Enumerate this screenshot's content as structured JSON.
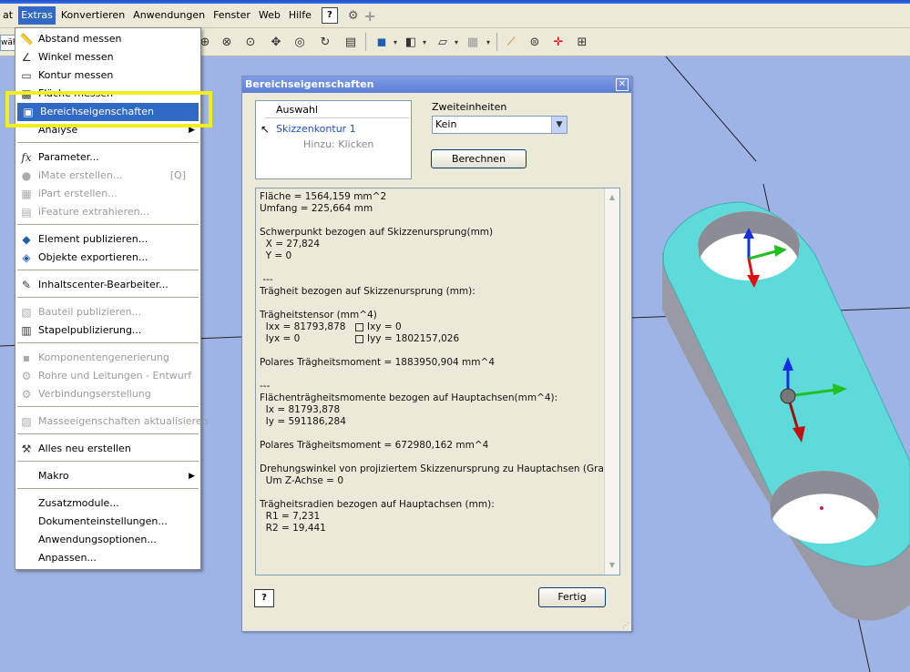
{
  "menubar": {
    "items": [
      "at",
      "Extras",
      "Konvertieren",
      "Anwendungen",
      "Fenster",
      "Web",
      "Hilfe"
    ],
    "combo_text": "wäh"
  },
  "menu": {
    "items": [
      {
        "label": "Abstand messen",
        "icon": "ruler-icon",
        "enabled": true
      },
      {
        "label": "Winkel messen",
        "icon": "angle-icon",
        "enabled": true
      },
      {
        "label": "Kontur messen",
        "icon": "loop-icon",
        "enabled": true
      },
      {
        "label": "Fläche messen",
        "icon": "area-icon",
        "enabled": true
      },
      {
        "label": "Bereichseigenschaften",
        "icon": "region-properties-icon",
        "enabled": true,
        "selected": true
      },
      {
        "label": "Analyse",
        "icon": "",
        "enabled": true,
        "submenu": true
      },
      {
        "label": "Parameter...",
        "icon": "fx-icon",
        "enabled": true
      },
      {
        "label": "iMate erstellen...",
        "icon": "imate-icon",
        "enabled": false,
        "shortcut": "[Q]"
      },
      {
        "label": "iPart erstellen...",
        "icon": "ipart-icon",
        "enabled": false
      },
      {
        "label": "iFeature extrahieren...",
        "icon": "ifeature-icon",
        "enabled": false
      },
      {
        "label": "Element publizieren...",
        "icon": "publish-icon",
        "enabled": true
      },
      {
        "label": "Objekte exportieren...",
        "icon": "export-icon",
        "enabled": true
      },
      {
        "label": "Inhaltscenter-Bearbeiter...",
        "icon": "content-center-icon",
        "enabled": true
      },
      {
        "label": "Bauteil publizieren...",
        "icon": "part-publish-icon",
        "enabled": false
      },
      {
        "label": "Stapelpublizierung...",
        "icon": "batch-publish-icon",
        "enabled": true
      },
      {
        "label": "Komponentengenerierung",
        "icon": "component-icon",
        "enabled": false
      },
      {
        "label": "Rohre und Leitungen - Entwurf",
        "icon": "pipes-icon",
        "enabled": false
      },
      {
        "label": "Verbindungserstellung",
        "icon": "connection-icon",
        "enabled": false
      },
      {
        "label": "Masseeigenschaften aktualisieren",
        "icon": "mass-properties-icon",
        "enabled": false
      },
      {
        "label": "Alles neu erstellen",
        "icon": "rebuild-icon",
        "enabled": true
      },
      {
        "label": "Makro",
        "icon": "",
        "enabled": true,
        "submenu": true
      },
      {
        "label": "Zusatzmodule...",
        "icon": "",
        "enabled": true
      },
      {
        "label": "Dokumenteinstellungen...",
        "icon": "",
        "enabled": true
      },
      {
        "label": "Anwendungsoptionen...",
        "icon": "",
        "enabled": true
      },
      {
        "label": "Anpassen...",
        "icon": "",
        "enabled": true
      }
    ]
  },
  "dialog": {
    "title": "Bereichseigenschaften",
    "auswahl": {
      "header": "Auswahl",
      "item": "Skizzenkontur 1",
      "hint": "Hinzu: Klicken"
    },
    "units_label": "Zweiteinheiten",
    "units_value": "Kein",
    "calc_button": "Berechnen",
    "results": [
      "Fläche = 1564,159 mm^2",
      "Umfang = 225,664 mm",
      "",
      "Schwerpunkt bezogen auf Skizzenursprung(mm)",
      "  X = 27,824",
      "  Y = 0",
      "",
      " ---",
      "Trägheit bezogen auf Skizzenursprung (mm):",
      "",
      "Trägheitstensor (mm^4)",
      "  Ixx = 81793,878",
      "  Iyx = 0",
      "",
      "Polares Trägheitsmoment = 1883950,904 mm^4",
      "",
      "---",
      "Flächenträgheitsmomente bezogen auf Hauptachsen(mm^4):",
      "  Ix = 81793,878",
      "  Iy = 591186,284",
      "",
      "Polares Trägheitsmoment = 672980,162 mm^4",
      "",
      "Drehungswinkel von projiziertem Skizzenursprung zu Hauptachsen (Grad):",
      "  Um Z-Achse = 0",
      "",
      "Trägheitsradien bezogen auf Hauptachsen (mm):",
      "  R1 = 7,231",
      "  R2 = 19,441"
    ],
    "tensor_col2": [
      "Ixy = 0",
      "Iyy = 1802157,026"
    ],
    "help_label": "?",
    "done_button": "Fertig"
  },
  "colors": {
    "viewport": "#9fb4e6",
    "part_face": "#5fdada",
    "part_side": "#9a9aa4",
    "highlight": "#f2ee1e",
    "selection": "#316ac5"
  }
}
